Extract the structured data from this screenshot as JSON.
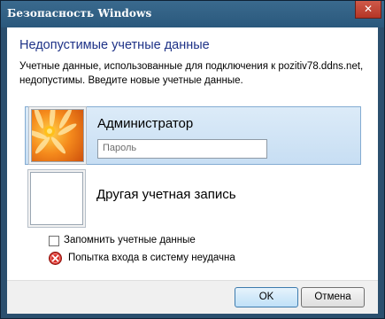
{
  "window": {
    "title": "Безопасность Windows",
    "close_glyph": "✕"
  },
  "dialog": {
    "heading": "Недопустимые учетные данные",
    "description": "Учетные данные, использованные для подключения к pozitiv78.ddns.net, недопустимы. Введите новые учетные данные."
  },
  "tiles": [
    {
      "user": "Администратор",
      "avatar_icon": "flower-avatar-icon",
      "password_placeholder": "Пароль",
      "selected": true
    },
    {
      "user": "Другая учетная запись",
      "avatar_icon": "blank-avatar-icon",
      "selected": false
    }
  ],
  "remember": {
    "label": "Запомнить учетные данные",
    "checked": false
  },
  "error": {
    "icon": "error-icon",
    "text": "Попытка входа в систему неудачна"
  },
  "buttons": {
    "ok": "OK",
    "cancel": "Отмена"
  },
  "colors": {
    "heading": "#1e3287",
    "selected_tile": "#cde3f6",
    "frame": "#2b4f6e"
  }
}
